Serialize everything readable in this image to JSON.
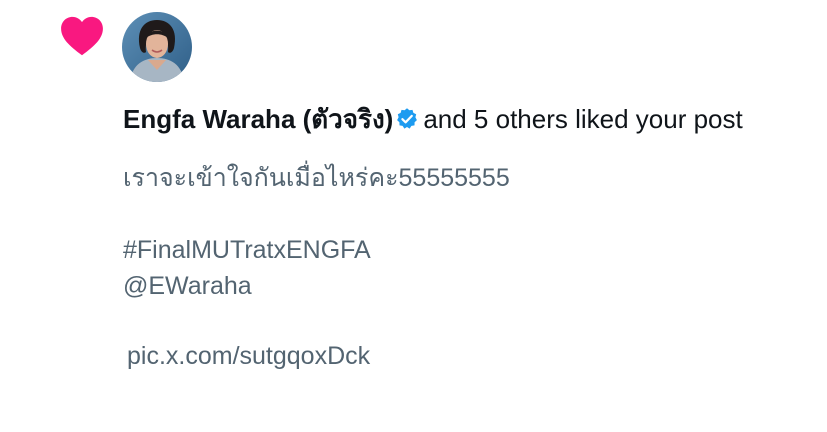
{
  "notification": {
    "username": "Engfa Waraha (ตัวจริง)",
    "action_text": "and 5 others liked your post",
    "post": {
      "text": "เราจะเข้าใจกันเมื่อไหร่คะ55555555",
      "hashtag": "#FinalMUTratxENGFA",
      "mention": "@EWaraha",
      "pic_link": "pic.x.com/sutgqoxDck"
    }
  },
  "colors": {
    "heart": "#f91880",
    "verified": "#1d9bf0",
    "primary_text": "#0f1419",
    "secondary_text": "#536471"
  },
  "icons": {
    "like": "heart-icon",
    "verified": "verified-badge-icon"
  }
}
